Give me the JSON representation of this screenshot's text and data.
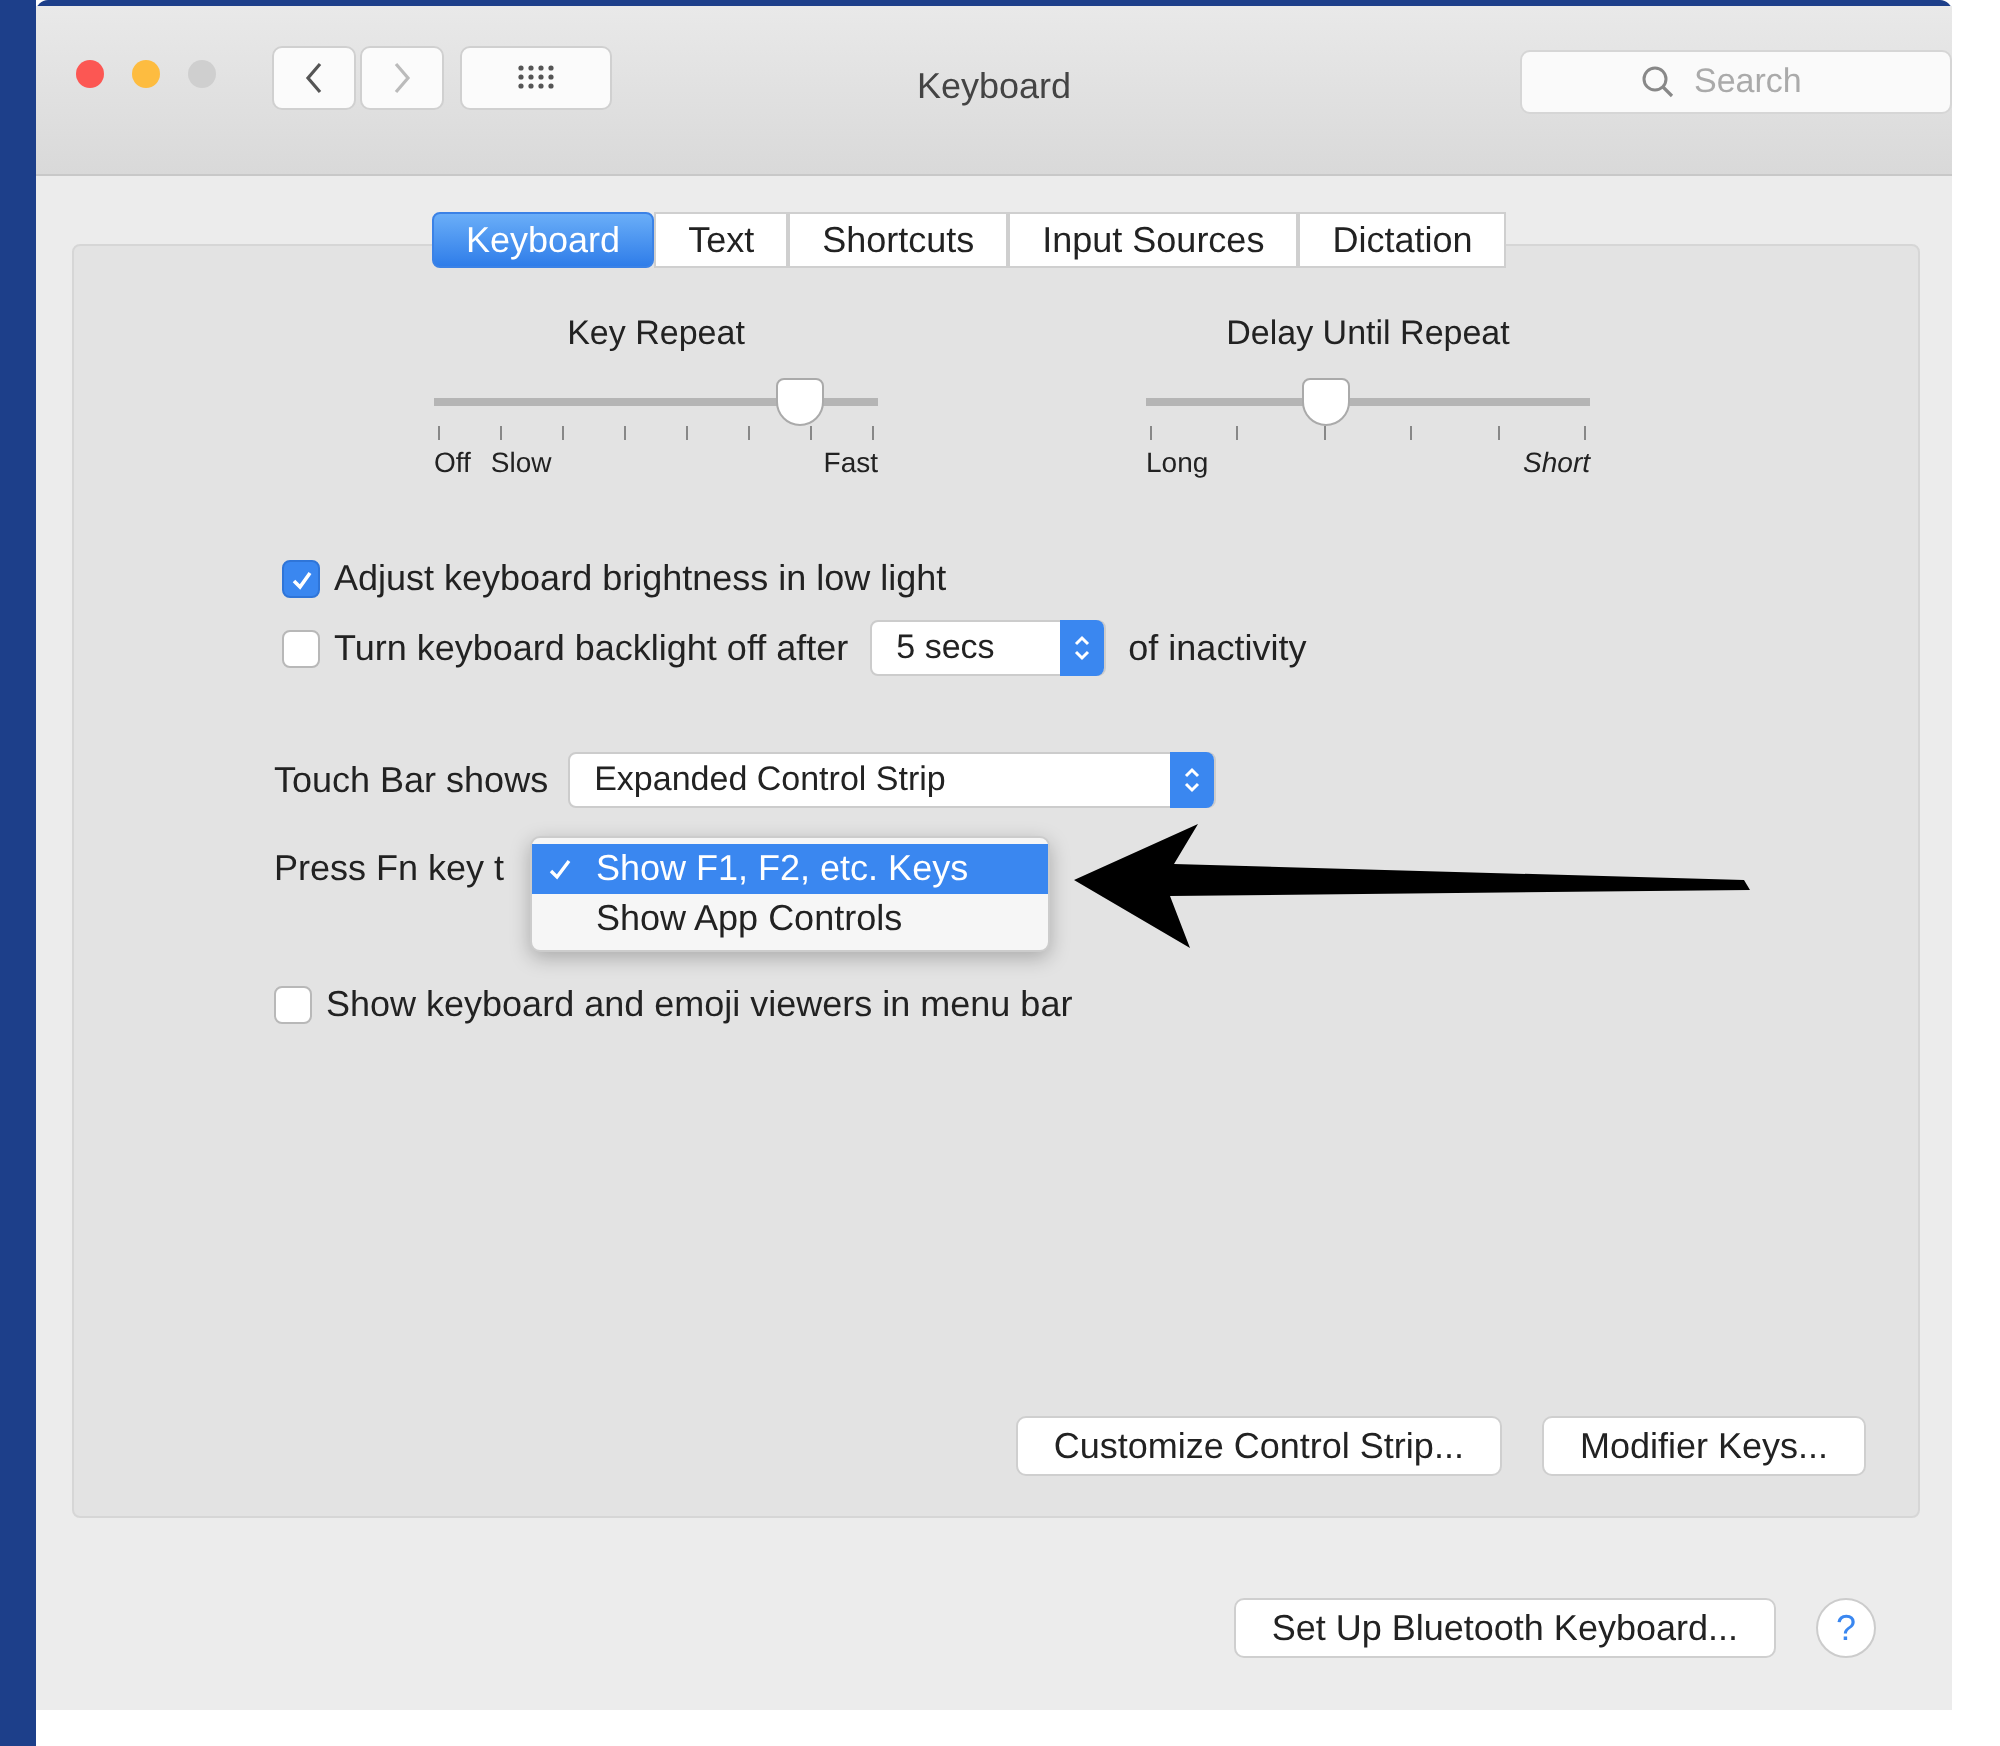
{
  "window": {
    "title": "Keyboard"
  },
  "search": {
    "placeholder": "Search"
  },
  "tabs": [
    {
      "label": "Keyboard",
      "selected": true
    },
    {
      "label": "Text",
      "selected": false
    },
    {
      "label": "Shortcuts",
      "selected": false
    },
    {
      "label": "Input Sources",
      "selected": false
    },
    {
      "label": "Dictation",
      "selected": false
    }
  ],
  "sliders": [
    {
      "kind": "key-repeat",
      "title": "Key Repeat",
      "level": 0.82,
      "labels": [
        "Off",
        "Slow",
        "Fast"
      ]
    },
    {
      "kind": "delay",
      "title": "Delay Until Repeat",
      "level": 0.4,
      "labels": [
        "Long",
        "Short"
      ]
    }
  ],
  "options": [
    {
      "kind": "checkbox",
      "label": "Adjust keyboard brightness in low light",
      "checked": true
    },
    {
      "kind": "checkbox-popup",
      "label": "Turn keyboard backlight off after",
      "checked": false,
      "popup": "5 secs",
      "suffix": "of inactivity"
    }
  ],
  "touch_bar": {
    "label": "Touch Bar shows",
    "value": "Expanded Control Strip"
  },
  "fn_key": {
    "label": "Press Fn key t",
    "menu": [
      {
        "label": "Show F1, F2, etc. Keys",
        "selected": true
      },
      {
        "label": "Show App Controls",
        "selected": false
      }
    ]
  },
  "emoji_option": {
    "label": "Show keyboard and emoji viewers in menu bar",
    "checked": false
  },
  "panel_buttons": [
    "Customize Control Strip...",
    "Modifier Keys..."
  ],
  "footer_button": "Set Up Bluetooth Keyboard...",
  "help_button": "?"
}
